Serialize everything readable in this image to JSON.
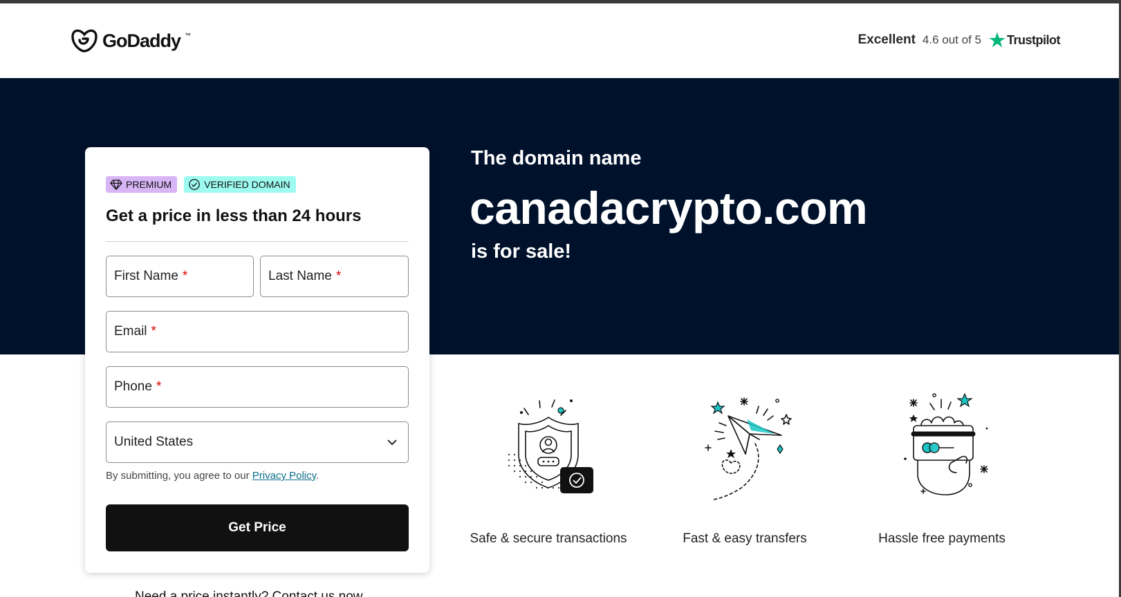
{
  "header": {
    "brand": "GoDaddy",
    "trustpilot": {
      "rating_word": "Excellent",
      "score": "4.6 out of 5",
      "brand": "Trustpilot"
    }
  },
  "hero": {
    "pre": "The domain name",
    "domain": "canadacrypto.com",
    "post": "is for sale!"
  },
  "form": {
    "badges": {
      "premium": "PREMIUM",
      "verified": "VERIFIED DOMAIN"
    },
    "title": "Get a price in less than 24 hours",
    "first_name": "First Name",
    "last_name": "Last Name",
    "email": "Email",
    "phone": "Phone",
    "required_mark": "*",
    "country": "United States",
    "consent_prefix": "By submitting, you agree to our ",
    "privacy_link": "Privacy Policy",
    "consent_suffix": ".",
    "submit": "Get Price"
  },
  "below_card": "Need a price instantly? Contact us now",
  "features": [
    {
      "label": "Safe & secure transactions",
      "icon": "shield-icon"
    },
    {
      "label": "Fast & easy transfers",
      "icon": "paper-plane-icon"
    },
    {
      "label": "Hassle free payments",
      "icon": "card-payment-icon"
    }
  ],
  "colors": {
    "hero_bg": "#00112b",
    "premium_badge": "#d8b5f5",
    "verified_badge": "#9dfbf0",
    "accent_teal": "#1bc5c5",
    "trustpilot_green": "#00b67a",
    "button_bg": "#111111"
  }
}
